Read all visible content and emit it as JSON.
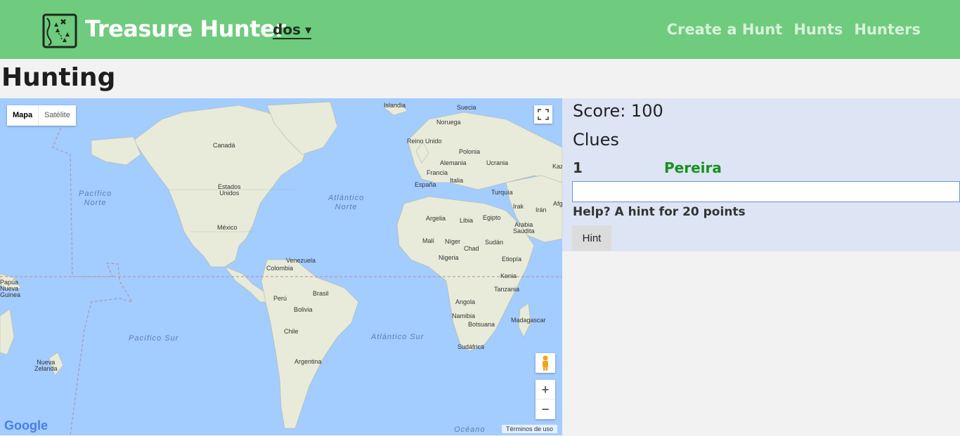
{
  "nav": {
    "brand": "Treasure Hunter",
    "user": "dos",
    "links": [
      "Create a Hunt",
      "Hunts",
      "Hunters"
    ]
  },
  "page": {
    "title": "Hunting"
  },
  "map": {
    "type_buttons": [
      "Mapa",
      "Satélite"
    ],
    "terms": "Términos de uso",
    "google_logo": "Google",
    "zoom_in": "+",
    "zoom_out": "−",
    "oceans": {
      "pacific_north": "Pacífico\nNorte",
      "atlantic_north": "Atlántico\nNorte",
      "pacific_south": "Pacífico Sur",
      "atlantic_south": "Atlántico Sur",
      "ocean_bottom": "Océano"
    },
    "labels": {
      "islandia": "Islandia",
      "suecia": "Suecia",
      "noruega": "Noruega",
      "reino_unido": "Reino Unido",
      "polonia": "Polonia",
      "alemania": "Alemania",
      "ucrania": "Ucrania",
      "kaz": "Kaz",
      "francia": "Francia",
      "espana": "España",
      "italia": "Italia",
      "turquia": "Turquía",
      "irak": "Irak",
      "iran": "Irán",
      "afg": "Afg",
      "argelia": "Argelia",
      "libia": "Libia",
      "egipto": "Egipto",
      "arabia": "Arabia\nSaudita",
      "mali": "Malí",
      "niger": "Níger",
      "chad": "Chad",
      "sudan": "Sudán",
      "nigeria": "Nigeria",
      "etiopia": "Etiopía",
      "kenia": "Kenia",
      "tanzania": "Tanzania",
      "angola": "Angola",
      "namibia": "Namibia",
      "botsuana": "Botsuana",
      "madagascar": "Madagascar",
      "sudafrica": "Sudáfrica",
      "canada": "Canadá",
      "eeuu": "Estados\nUnidos",
      "mexico": "México",
      "venezuela": "Venezuela",
      "colombia": "Colombia",
      "peru": "Perú",
      "brasil": "Brasil",
      "bolivia": "Bolivia",
      "chile": "Chile",
      "argentina": "Argentina",
      "papua": "Papúa\nNueva\nGuinea",
      "nueva_zelanda": "Nueva\nZelanda"
    }
  },
  "panel": {
    "score": "Score: 100",
    "clues_heading": "Clues",
    "clue_number": "1",
    "clue_text": "Pereira",
    "answer_value": "",
    "help_text": "Help? A hint for 20 points",
    "hint_button": "Hint"
  },
  "colors": {
    "navbar": "#6fcb7d",
    "ocean": "#a3ccff",
    "land": "#e8ebd9",
    "panel": "#dde4f4",
    "clue_text": "#17911d"
  }
}
